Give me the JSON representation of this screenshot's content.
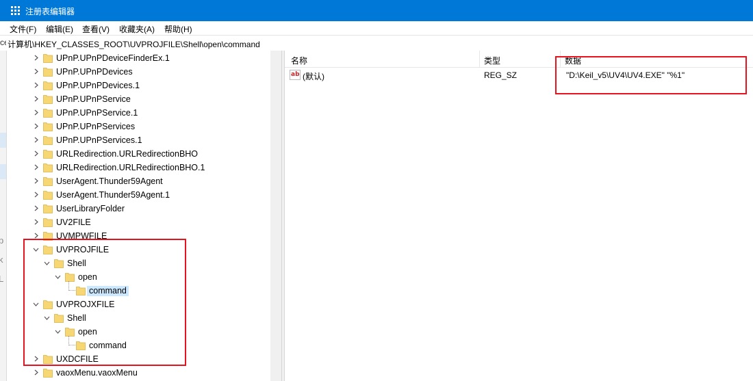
{
  "window": {
    "title": "注册表编辑器",
    "app_icon": "regedit-icon"
  },
  "menu": [
    "文件(F)",
    "编辑(E)",
    "查看(V)",
    "收藏夹(A)",
    "帮助(H)"
  ],
  "address": {
    "path": "计算机\\HKEY_CLASSES_ROOT\\UVPROJFILE\\Shell\\open\\command",
    "left_partial": "ce"
  },
  "tree": {
    "rows": [
      {
        "label": "UPnP.UPnPDeviceFinderEx.1",
        "level": 0,
        "expander": "collapsed"
      },
      {
        "label": "UPnP.UPnPDevices",
        "level": 0,
        "expander": "collapsed"
      },
      {
        "label": "UPnP.UPnPDevices.1",
        "level": 0,
        "expander": "collapsed"
      },
      {
        "label": "UPnP.UPnPService",
        "level": 0,
        "expander": "collapsed"
      },
      {
        "label": "UPnP.UPnPService.1",
        "level": 0,
        "expander": "collapsed"
      },
      {
        "label": "UPnP.UPnPServices",
        "level": 0,
        "expander": "collapsed"
      },
      {
        "label": "UPnP.UPnPServices.1",
        "level": 0,
        "expander": "collapsed"
      },
      {
        "label": "URLRedirection.URLRedirectionBHO",
        "level": 0,
        "expander": "collapsed"
      },
      {
        "label": "URLRedirection.URLRedirectionBHO.1",
        "level": 0,
        "expander": "collapsed"
      },
      {
        "label": "UserAgent.Thunder59Agent",
        "level": 0,
        "expander": "collapsed"
      },
      {
        "label": "UserAgent.Thunder59Agent.1",
        "level": 0,
        "expander": "collapsed"
      },
      {
        "label": "UserLibraryFolder",
        "level": 0,
        "expander": "collapsed"
      },
      {
        "label": "UV2FILE",
        "level": 0,
        "expander": "collapsed"
      },
      {
        "label": "UVMPWFILE",
        "level": 0,
        "expander": "collapsed"
      },
      {
        "label": "UVPROJFILE",
        "level": 0,
        "expander": "expanded"
      },
      {
        "label": "Shell",
        "level": 1,
        "expander": "expanded"
      },
      {
        "label": "open",
        "level": 2,
        "expander": "expanded"
      },
      {
        "label": "command",
        "level": 3,
        "expander": "leaf",
        "selected": true
      },
      {
        "label": "UVPROJXFILE",
        "level": 0,
        "expander": "expanded"
      },
      {
        "label": "Shell",
        "level": 1,
        "expander": "expanded"
      },
      {
        "label": "open",
        "level": 2,
        "expander": "expanded"
      },
      {
        "label": "command",
        "level": 3,
        "expander": "leaf"
      },
      {
        "label": "UXDCFILE",
        "level": 0,
        "expander": "collapsed"
      },
      {
        "label": "vaoxMenu.vaoxMenu",
        "level": 0,
        "expander": "collapsed"
      }
    ]
  },
  "values_table": {
    "columns": [
      "名称",
      "类型",
      "数据"
    ],
    "rows": [
      {
        "name": "(默认)",
        "type": "REG_SZ",
        "data": "\"D:\\Keil_v5\\UV4\\UV4.EXE\" \"%1\"",
        "icon": "string-value-icon",
        "icon_text": "ab"
      }
    ]
  },
  "left_strip_glyphs": [
    "p",
    "k",
    "L"
  ],
  "colors": {
    "titlebar": "#0078d7",
    "selection": "#cce8ff",
    "highlight_box": "#e8121f",
    "folder": "#f7d774"
  }
}
